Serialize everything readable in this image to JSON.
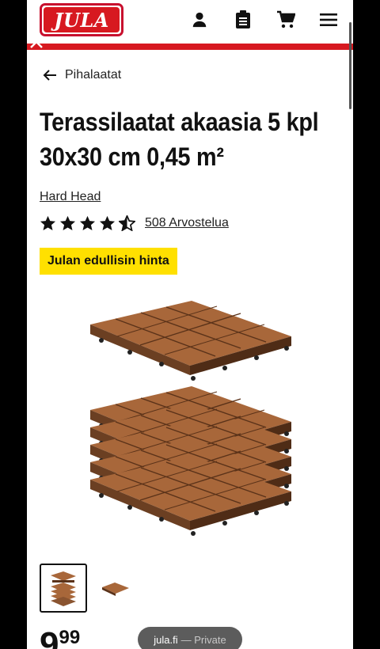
{
  "header": {
    "logo_text": "JULA",
    "icons": [
      "user-icon",
      "shopping-list-icon",
      "cart-icon",
      "menu-icon"
    ]
  },
  "breadcrumb": {
    "label": "Pihalaatat"
  },
  "product": {
    "title_line1": "Terassilaatat akaasia 5 kpl",
    "title_line2": "30x30 cm 0,45 m²",
    "brand": "Hard Head",
    "rating": 4.5,
    "reviews": "508 Arvostelua",
    "badge": "Julan edullisin hinta",
    "price_main": "9",
    "price_cents": "99"
  },
  "browser": {
    "domain": "jula.fi",
    "mode": "— Private"
  },
  "colors": {
    "brand_red": "#d71920",
    "badge_yellow": "#ffe000"
  }
}
